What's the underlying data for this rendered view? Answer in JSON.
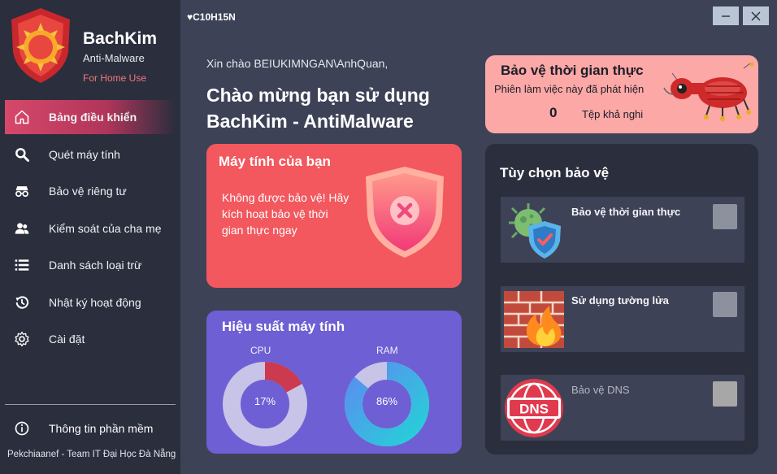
{
  "window": {
    "title": "♥C10H15N"
  },
  "brand": {
    "name": "BachKim",
    "subtitle": "Anti-Malware",
    "tagline": "For Home Use"
  },
  "sidebar": {
    "items": [
      {
        "label": "Bảng điều khiển",
        "icon": "home-icon",
        "active": true
      },
      {
        "label": "Quét máy tính",
        "icon": "search-icon"
      },
      {
        "label": "Bảo vệ riêng tư",
        "icon": "incognito-icon"
      },
      {
        "label": "Kiểm soát của cha mẹ",
        "icon": "users-icon"
      },
      {
        "label": "Danh sách loại trừ",
        "icon": "list-icon"
      },
      {
        "label": "Nhật ký hoạt động",
        "icon": "history-icon"
      },
      {
        "label": "Cài đặt",
        "icon": "gear-icon"
      }
    ],
    "info_label": "Thông tin phần mềm",
    "footer": "Pekchiaanef - Team IT Đại Học Đà Nẵng"
  },
  "main": {
    "greeting": "Xin chào BEIUKIMNGAN\\AnhQuan,",
    "welcome": "Chào mừng bạn sử dụng BachKim - AntiMalware"
  },
  "computer_card": {
    "title": "Máy tính của bạn",
    "message": "Không được bảo vệ! Hãy kích hoạt bảo vệ thời gian thực ngay"
  },
  "performance": {
    "title": "Hiệu suất máy tính",
    "cpu_label": "CPU",
    "cpu_percent": 17,
    "cpu_text": "17%",
    "ram_label": "RAM",
    "ram_percent": 86,
    "ram_text": "86%"
  },
  "realtime": {
    "title": "Bảo vệ thời gian thực",
    "subtitle": "Phiên làm việc này đã phát hiện",
    "count": "0",
    "files_label": "Tệp khả nghi"
  },
  "options": {
    "title": "Tùy chọn bảo vệ",
    "items": [
      {
        "label": "Bảo vệ thời gian thực",
        "icon": "virus-shield-icon"
      },
      {
        "label": "Sử dụng tường lửa",
        "icon": "firewall-icon"
      },
      {
        "label": "Bảo vệ DNS",
        "icon": "dns-icon"
      }
    ]
  },
  "colors": {
    "accent": "#d7486a",
    "danger_card": "#f2585e",
    "performance_card": "#6e5fd4",
    "realtime_card": "#fba8a6"
  }
}
